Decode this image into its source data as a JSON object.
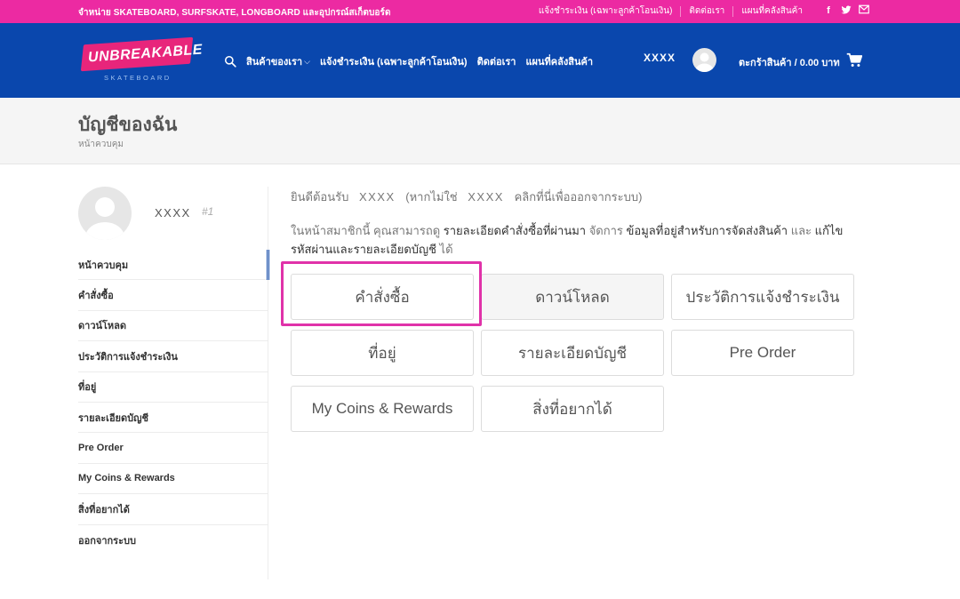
{
  "topbar": {
    "promo": "จำหน่าย SKATEBOARD, SURFSKATE, LONGBOARD และอุปกรณ์สเก็ตบอร์ด",
    "links": [
      "แจ้งชำระเงิน (เฉพาะลูกค้าโอนเงิน)",
      "ติดต่อเรา",
      "แผนที่คลังสินค้า"
    ],
    "social_icons": [
      "facebook-icon",
      "twitter-icon",
      "email-icon"
    ]
  },
  "header": {
    "logo_text": "UNBREAKABLE",
    "logo_sub": "SKATEBOARD",
    "nav": [
      "สินค้าของเรา",
      "แจ้งชำระเงิน (เฉพาะลูกค้าโอนเงิน)",
      "ติดต่อเรา",
      "แผนที่คลังสินค้า"
    ],
    "nav_dropdown_glyph": "⌵",
    "username": "XXXX",
    "cart_label": "ตะกร้าสินค้า / 0.00 บาท"
  },
  "page": {
    "title": "บัญชีของฉัน",
    "breadcrumb": "หน้าควบคุม"
  },
  "sidebar": {
    "name": "XXXX",
    "id": "#1",
    "items": [
      "หน้าควบคุม",
      "คำสั่งซื้อ",
      "ดาวน์โหลด",
      "ประวัติการแจ้งชำระเงิน",
      "ที่อยู่",
      "รายละเอียดบัญชี",
      "Pre Order",
      "My Coins & Rewards",
      "สิ่งที่อยากได้",
      "ออกจากระบบ"
    ]
  },
  "content": {
    "welcome_prefix": "ยินดีต้อนรับ",
    "welcome_name": "XXXX",
    "welcome_not_prefix": "(หากไม่ใช่",
    "welcome_not_name": "XXXX",
    "welcome_logout": "คลิกที่นี่เพื่อออกจากระบบ)",
    "intro_1": "ในหน้าสมาชิกนี้ คุณสามารถดู ",
    "intro_link_1": "รายละเอียดคำสั่งซื้อที่ผ่านมา",
    "intro_2": " จัดการ ",
    "intro_link_2": "ข้อมูลที่อยู่สำหรับการจัดส่งสินค้า",
    "intro_3": " และ ",
    "intro_link_3": "แก้ไขรหัสผ่านและรายละเอียดบัญชี",
    "intro_4": " ได้",
    "tiles": [
      "คำสั่งซื้อ",
      "ดาวน์โหลด",
      "ประวัติการแจ้งชำระเงิน",
      "ที่อยู่",
      "รายละเอียดบัญชี",
      "Pre Order",
      "My Coins & Rewards",
      "สิ่งที่อยากได้"
    ]
  },
  "colors": {
    "topbar": "#ec2aa2",
    "header": "#0a47ad",
    "highlight": "#e032a9"
  }
}
